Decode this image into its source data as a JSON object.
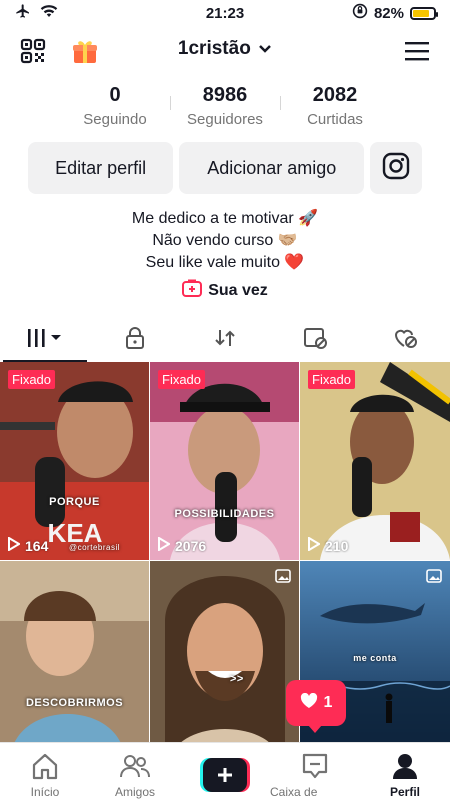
{
  "status_bar": {
    "time": "21:23",
    "battery": "82%",
    "battery_level": 0.82
  },
  "header": {
    "username": "1cristão"
  },
  "stats": [
    {
      "value": "0",
      "label": "Seguindo"
    },
    {
      "value": "8986",
      "label": "Seguidores"
    },
    {
      "value": "2082",
      "label": "Curtidas"
    }
  ],
  "buttons": {
    "edit": "Editar perfil",
    "add_friend": "Adicionar amigo"
  },
  "bio": {
    "lines": [
      "Me dedico a te motivar 🚀",
      "Não vendo curso 🤝🏼",
      "Seu like vale muito ❤️"
    ],
    "link": "Sua vez"
  },
  "tabs": [
    "videos",
    "private",
    "reposts",
    "favorites",
    "liked"
  ],
  "videos": [
    {
      "pinned": "Fixado",
      "views": "164",
      "caption": "PORQUE",
      "watermark": "@cortebrasil"
    },
    {
      "pinned": "Fixado",
      "views": "2076",
      "caption": "POSSIBILIDADES"
    },
    {
      "pinned": "Fixado",
      "views": "210"
    },
    {
      "caption": "DESCOBRIRMOS"
    },
    {
      "caption": ">>"
    },
    {
      "caption": "me conta"
    }
  ],
  "likes_notification": {
    "count": "1"
  },
  "bottom_nav": [
    {
      "label": "Início"
    },
    {
      "label": "Amigos"
    },
    {
      "label": ""
    },
    {
      "label": "Caixa de entrada"
    },
    {
      "label": "Perfil"
    }
  ],
  "colors": {
    "accent": "#fe2c55",
    "text": "#161823",
    "muted": "#757575",
    "button_bg": "#f1f1f2"
  }
}
